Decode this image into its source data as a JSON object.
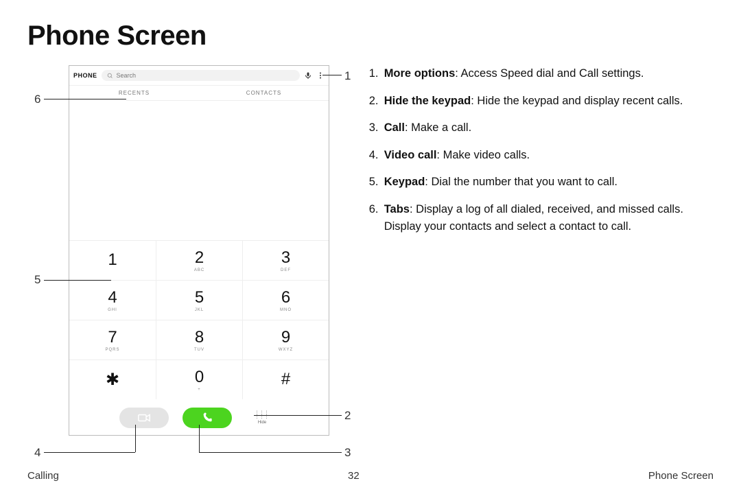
{
  "title": "Phone Screen",
  "phone": {
    "label": "PHONE",
    "search_placeholder": "Search",
    "tabs": {
      "recents": "RECENTS",
      "contacts": "CONTACTS"
    },
    "keypad": [
      {
        "digit": "1",
        "letters": ""
      },
      {
        "digit": "2",
        "letters": "ABC"
      },
      {
        "digit": "3",
        "letters": "DEF"
      },
      {
        "digit": "4",
        "letters": "GHI"
      },
      {
        "digit": "5",
        "letters": "JKL"
      },
      {
        "digit": "6",
        "letters": "MNO"
      },
      {
        "digit": "7",
        "letters": "PQRS"
      },
      {
        "digit": "8",
        "letters": "TUV"
      },
      {
        "digit": "9",
        "letters": "WXYZ"
      },
      {
        "digit": "✱",
        "letters": ""
      },
      {
        "digit": "0",
        "letters": "+"
      },
      {
        "digit": "#",
        "letters": ""
      }
    ],
    "hide_label": "Hide"
  },
  "callouts": {
    "n1": "1",
    "n2": "2",
    "n3": "3",
    "n4": "4",
    "n5": "5",
    "n6": "6"
  },
  "list": [
    {
      "n": "1.",
      "bold": "More options",
      "rest": ": Access Speed dial and Call settings."
    },
    {
      "n": "2.",
      "bold": "Hide the keypad",
      "rest": ": Hide the keypad and display recent calls."
    },
    {
      "n": "3.",
      "bold": "Call",
      "rest": ": Make a call."
    },
    {
      "n": "4.",
      "bold": "Video call",
      "rest": ": Make video calls."
    },
    {
      "n": "5.",
      "bold": "Keypad",
      "rest": ": Dial the number that you want to call."
    },
    {
      "n": "6.",
      "bold": "Tabs",
      "rest": ": Display a log of all dialed, received, and missed calls. Display your contacts and select a contact to call."
    }
  ],
  "footer": {
    "left": "Calling",
    "center": "32",
    "right": "Phone Screen"
  }
}
